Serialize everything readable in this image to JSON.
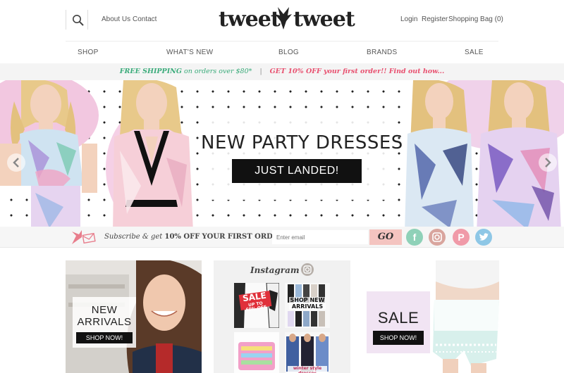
{
  "header": {
    "about": "About Us",
    "contact": "Contact",
    "logo_left": "tweet",
    "logo_right": "tweet",
    "login": "Login",
    "register": "Register",
    "bag": "Shopping Bag (0)"
  },
  "nav": [
    "SHOP",
    "WHAT'S NEW",
    "BLOG",
    "BRANDS",
    "SALE"
  ],
  "promo": {
    "free_shipping": "FREE SHIPPING",
    "free_shipping_rest": "on orders over $80*",
    "separator": "|",
    "offer": "GET 10% OFF your first order!! Find out how..."
  },
  "hero": {
    "title": "NEW PARTY DRESSES",
    "cta": "JUST LANDED!"
  },
  "subscribe": {
    "text_prefix": "Subscribe & get",
    "text_bold": "10% OFF",
    "text_suffix": "YOUR FIRST ORDER!",
    "placeholder": "Enter email",
    "go": "GO",
    "social": [
      "facebook-icon",
      "instagram-icon",
      "pinterest-icon",
      "twitter-icon"
    ]
  },
  "tiles": {
    "new_arrivals_line1": "NEW",
    "new_arrivals_line2": "ARRIVALS",
    "new_arrivals_btn": "SHOP NOW!",
    "instagram_title": "Instagram",
    "thumb_sale": "SALE",
    "thumb_sale_sub": "UP TO 60% OFF",
    "thumb_arrivals": "SHOP NEW ARRIVALS",
    "thumb_style": "winter style dresses",
    "sale_title": "SALE",
    "sale_btn": "SHOP NOW!"
  },
  "colors": {
    "promo_green": "#3aab7a",
    "promo_pink": "#e8506f",
    "facebook": "#8fd1b8",
    "instagram": "#d9a59e",
    "pinterest": "#f09aa8",
    "twitter": "#8ec7e6"
  }
}
